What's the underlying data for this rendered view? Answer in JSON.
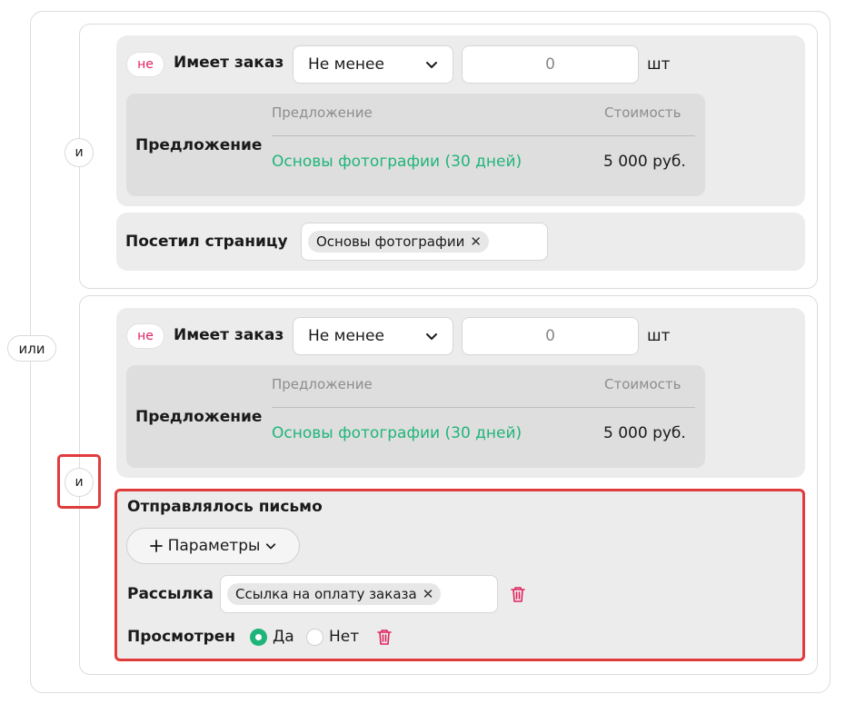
{
  "logic": {
    "or_label": "или",
    "and_label": "и",
    "not_label": "не"
  },
  "group1": {
    "order": {
      "label": "Имеет заказ",
      "operator": "Не менее",
      "quantity": "0",
      "unit": "шт"
    },
    "offer": {
      "label": "Предложение",
      "col_offer": "Предложение",
      "col_price": "Стоимость",
      "row_name": "Основы фотографии (30 дней)",
      "row_price": "5 000 руб."
    },
    "visited": {
      "label": "Посетил страницу",
      "tag": "Основы фотографии"
    }
  },
  "group2": {
    "order": {
      "label": "Имеет заказ",
      "operator": "Не менее",
      "quantity": "0",
      "unit": "шт"
    },
    "offer": {
      "label": "Предложение",
      "col_offer": "Предложение",
      "col_price": "Стоимость",
      "row_name": "Основы фотографии (30 дней)",
      "row_price": "5 000 руб."
    },
    "letter": {
      "title": "Отправлялось письмо",
      "params_button": "Параметры",
      "mailing_label": "Рассылка",
      "mailing_tag": "Ссылка на оплату заказа",
      "viewed_label": "Просмотрен",
      "opt_yes": "Да",
      "opt_no": "Нет"
    }
  },
  "colors": {
    "accent_green": "#1fb57a",
    "not_red": "#e0245e",
    "highlight_red": "#e03c3c"
  },
  "icons": {
    "chevron": "chevron-down-icon",
    "close": "close-icon",
    "plus": "plus-icon",
    "trash": "trash-icon"
  }
}
